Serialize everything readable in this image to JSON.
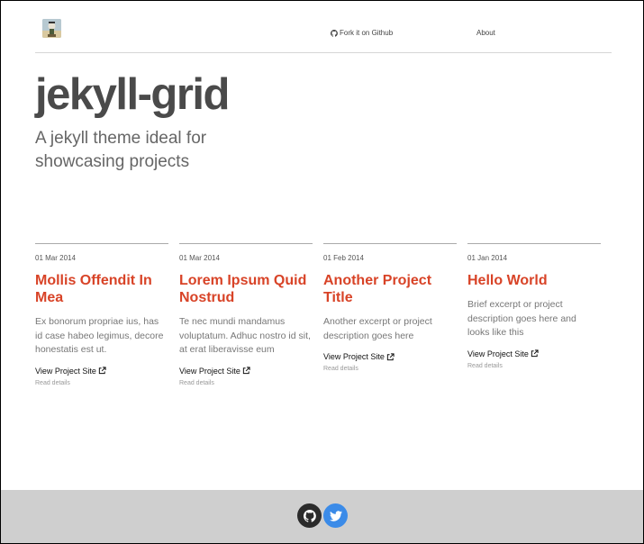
{
  "header": {
    "logo_alt": "site-logo",
    "nav": [
      {
        "label": "Fork it on Github",
        "icon": "github-icon"
      },
      {
        "label": "About"
      }
    ]
  },
  "hero": {
    "title": "jekyll-grid",
    "tagline": "A jekyll theme ideal for showcasing projects"
  },
  "cards": [
    {
      "date": "01 Mar 2014",
      "title": "Mollis Offendit In Mea",
      "excerpt": "Ex bonorum propriae ius, has id case habeo legimus, decore honestatis est ut.",
      "link_label": "View Project Site",
      "details_label": "Read details"
    },
    {
      "date": "01 Mar 2014",
      "title": "Lorem Ipsum Quid Nostrud",
      "excerpt": "Te nec mundi mandamus voluptatum. Adhuc nostro id sit, at erat liberavisse eum",
      "link_label": "View Project Site",
      "details_label": "Read details"
    },
    {
      "date": "01 Feb 2014",
      "title": "Another Project Title",
      "excerpt": "Another excerpt or project description goes here",
      "link_label": "View Project Site",
      "details_label": "Read details"
    },
    {
      "date": "01 Jan 2014",
      "title": "Hello World",
      "excerpt": "Brief excerpt or project description goes here and looks like this",
      "link_label": "View Project Site",
      "details_label": "Read details"
    }
  ],
  "footer": {
    "social": [
      {
        "icon": "github-icon",
        "color": "#2b2b2b"
      },
      {
        "icon": "twitter-icon",
        "color": "#3b8be8"
      }
    ]
  },
  "colors": {
    "accent": "#d84327",
    "title": "#4a4a4a",
    "footer_bg": "#cfcfcf"
  }
}
